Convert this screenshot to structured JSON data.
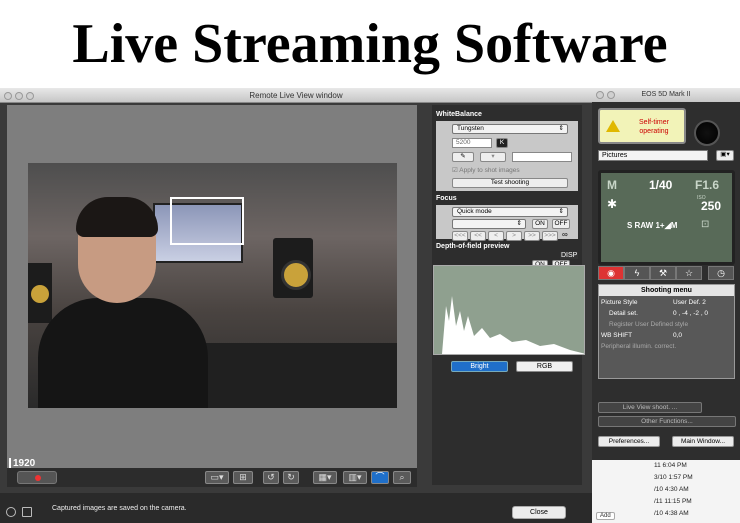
{
  "banner": {
    "title": "Live Streaming Software"
  },
  "rlv": {
    "window_title": "Remote Live View window",
    "res_badge": "1920",
    "status_text": "Captured images are saved on the camera.",
    "close_label": "Close",
    "toolbar_icons": [
      "record-button",
      "aspect-icon",
      "grid-toggle-icon",
      "rotate-left-icon",
      "rotate-right-icon",
      "grid-icon",
      "zoom-icon",
      "face-detect-icon",
      "magnify-icon"
    ]
  },
  "white_balance": {
    "header": "WhiteBalance",
    "mode": "Tungsten",
    "kelvin": "5200",
    "kelvin_unit": "K",
    "apply_label": "Apply to shot images",
    "test_label": "Test shooting"
  },
  "focus": {
    "header": "Focus",
    "mode": "Quick mode",
    "on_label": "ON",
    "off_label": "OFF",
    "nav_buttons": [
      "<<<",
      "<<",
      "<",
      ">",
      ">>",
      ">>>"
    ],
    "inf_label": "∞"
  },
  "dof": {
    "header": "Depth-of-field preview",
    "on_label": "ON",
    "off_label": "OFF"
  },
  "histogram": {
    "disp_label": "DISP",
    "bright_label": "Bright",
    "rgb_label": "RGB"
  },
  "eos": {
    "window_title": "EOS 5D Mark II",
    "warning": "Self-timer operating",
    "save_location": "Pictures",
    "lcd": {
      "mode": "M",
      "shutter": "1/40",
      "aperture": "F1.6",
      "iso": "250",
      "iso_label": "ISO",
      "quality": "S RAW 1+◢M"
    },
    "menu_title": "Shooting menu",
    "menu_rows": [
      {
        "label": "Picture Style",
        "value": "User Def. 2"
      },
      {
        "label": "Detail set.",
        "value": "0 , -4 , -2 , 0"
      },
      {
        "label": "Register User Defined style",
        "value": ""
      },
      {
        "label": "WB SHIFT",
        "value": "0,0"
      },
      {
        "label": "Peripheral illumin. correct.",
        "value": ""
      }
    ],
    "live_view_label": "Live View shoot. ...",
    "other_functions_label": "Other Functions...",
    "preferences_label": "Preferences...",
    "main_window_label": "Main Window..."
  },
  "finder": {
    "rows": [
      "11 6:04 PM",
      "3/10 1:57 PM",
      "/10 4:30 AM",
      "/11 11:15 PM",
      "/10 4:38 AM"
    ],
    "add_label": "Add"
  }
}
